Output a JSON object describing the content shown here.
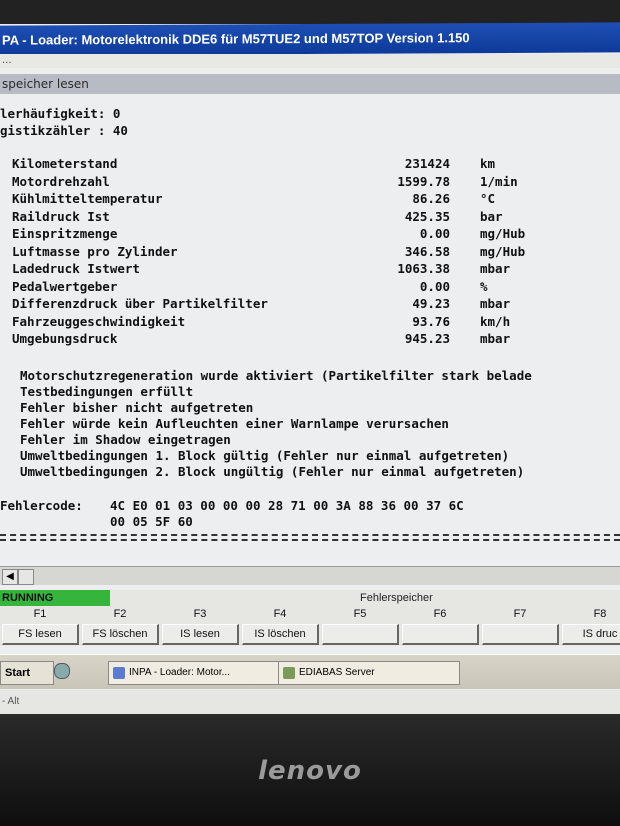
{
  "window": {
    "title": "PA - Loader: Motorelektronik DDE6 für M57TUE2 und M57TOP Version 1.150",
    "menu_text": "..."
  },
  "panel": {
    "title": "speicher lesen"
  },
  "header_lines": [
    "lerhäufigkeit:  0",
    "gistikzähler  : 40"
  ],
  "measurements": [
    {
      "label": "Kilometerstand",
      "value": "231424",
      "unit": "km"
    },
    {
      "label": "Motordrehzahl",
      "value": "1599.78",
      "unit": "1/min"
    },
    {
      "label": "Kühlmitteltemperatur",
      "value": "86.26",
      "unit": "°C"
    },
    {
      "label": "Raildruck Ist",
      "value": "425.35",
      "unit": "bar"
    },
    {
      "label": "Einspritzmenge",
      "value": "0.00",
      "unit": "mg/Hub"
    },
    {
      "label": "Luftmasse pro Zylinder",
      "value": "346.58",
      "unit": "mg/Hub"
    },
    {
      "label": "Ladedruck Istwert",
      "value": "1063.38",
      "unit": "mbar"
    },
    {
      "label": "Pedalwertgeber",
      "value": "0.00",
      "unit": "%"
    },
    {
      "label": "Differenzdruck über Partikelfilter",
      "value": "49.23",
      "unit": "mbar"
    },
    {
      "label": "Fahrzeuggeschwindigkeit",
      "value": "93.76",
      "unit": "km/h"
    },
    {
      "label": "Umgebungsdruck",
      "value": "945.23",
      "unit": "mbar"
    }
  ],
  "messages": [
    "Motorschutzregeneration wurde aktiviert (Partikelfilter stark belade",
    "Testbedingungen erfüllt",
    "Fehler bisher nicht aufgetreten",
    "Fehler würde kein Aufleuchten einer Warnlampe verursachen",
    "Fehler im Shadow eingetragen",
    "Umweltbedingungen 1. Block gültig (Fehler nur einmal aufgetreten)",
    "Umweltbedingungen 2. Block ungültig (Fehler nur einmal aufgetreten)"
  ],
  "fehlercode": {
    "label": "Fehlercode:",
    "line1": "4C E0 01 03 00 00 00 28  71 00 3A 88 36 00 37 6C",
    "line2": "00 05 5F 60"
  },
  "status": {
    "running": "RUNNING",
    "title": "Fehlerspeicher"
  },
  "fkeys": [
    {
      "key": "F1",
      "label": "FS lesen"
    },
    {
      "key": "F2",
      "label": "FS löschen"
    },
    {
      "key": "F3",
      "label": "IS lesen"
    },
    {
      "key": "F4",
      "label": "IS löschen"
    },
    {
      "key": "F5",
      "label": ""
    },
    {
      "key": "F6",
      "label": ""
    },
    {
      "key": "F7",
      "label": ""
    },
    {
      "key": "F8",
      "label": "IS druc"
    }
  ],
  "taskbar": {
    "start": "Start",
    "tasks": [
      "INPA - Loader: Motor...",
      "EDIABAS Server"
    ]
  },
  "bottom_text": "- Alt",
  "brand": "lenovo"
}
